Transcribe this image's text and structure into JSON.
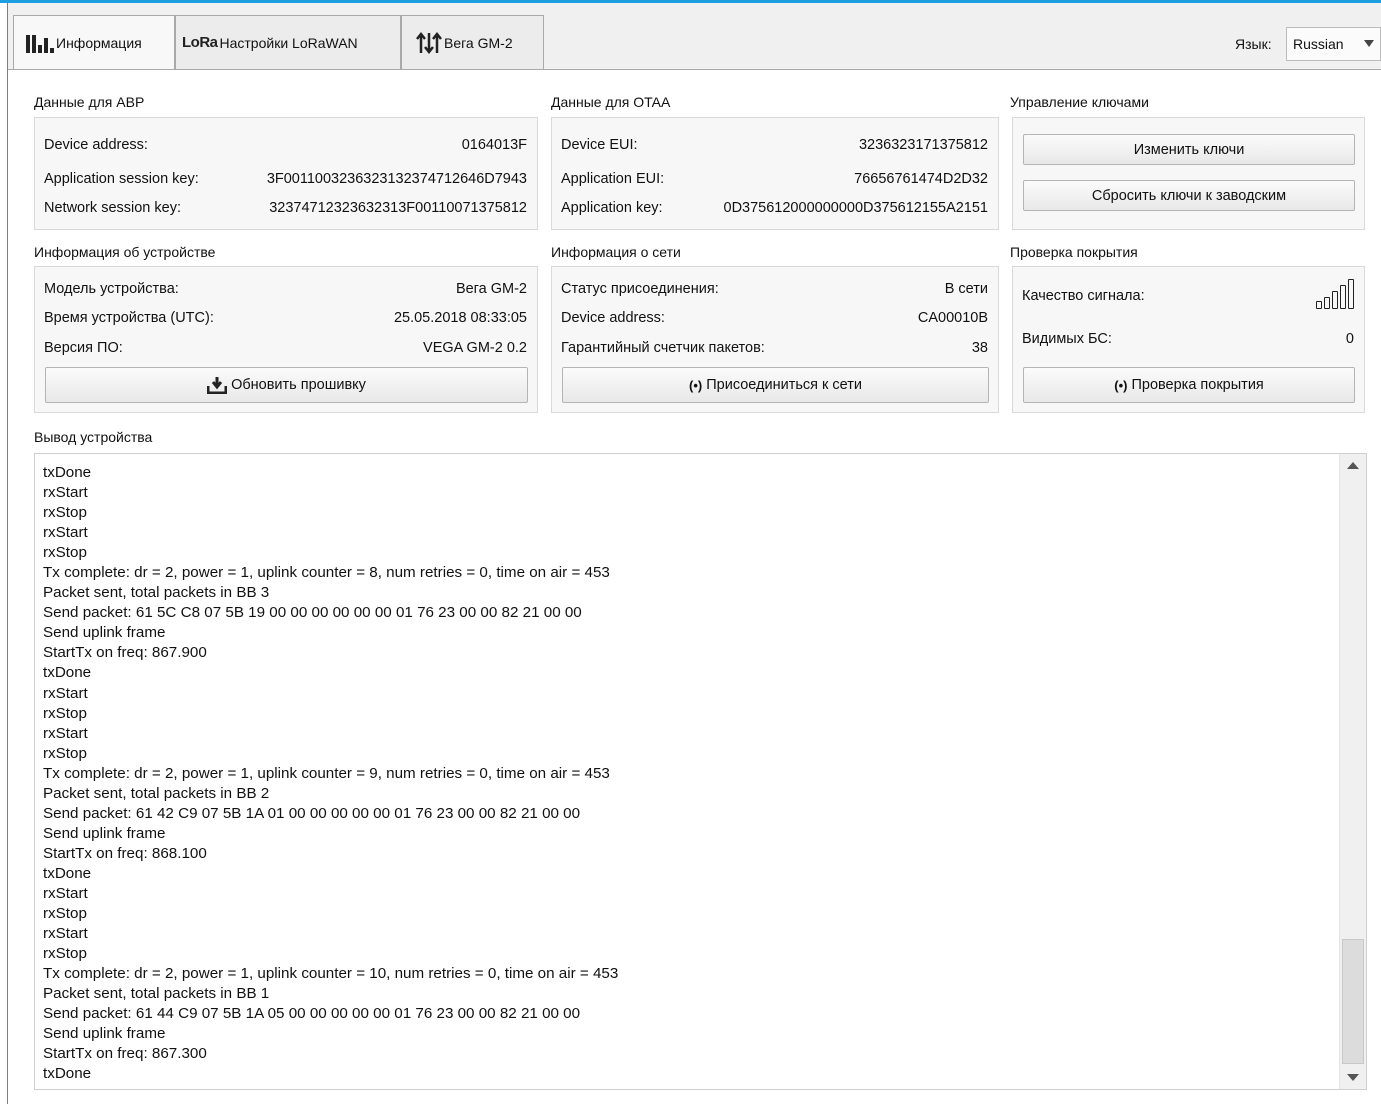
{
  "tabs": [
    {
      "label": "Информация",
      "icon": "bar-chart-icon",
      "active": true
    },
    {
      "label": "Настройки LoRaWAN",
      "logo": "LoRa",
      "icon": "lora-logo"
    },
    {
      "label": "Вега GM-2",
      "icon": "arrows-icon"
    }
  ],
  "language": {
    "label": "Язык:",
    "value": "Russian"
  },
  "abp": {
    "title": "Данные для ABP",
    "rows": [
      {
        "label": "Device address:",
        "value": "0164013F"
      },
      {
        "label": "Application session key:",
        "value": "3F00110032363231323747126 46D7943"
      },
      {
        "label": "Network session key:",
        "value": "32374712323632313F00110071375812"
      }
    ]
  },
  "otaa": {
    "title": "Данные для OTAA",
    "rows": [
      {
        "label": "Device EUI:",
        "value": "3236323171375812"
      },
      {
        "label": "Application EUI:",
        "value": "76656761474D2D32"
      },
      {
        "label": "Application key:",
        "value": "0D375612000000000D375612155A2151"
      }
    ]
  },
  "keys": {
    "title": "Управление ключами",
    "change_button": "Изменить ключи",
    "reset_button": "Сбросить ключи к заводским"
  },
  "device": {
    "title": "Информация об устройстве",
    "rows": [
      {
        "label": "Модель устройства:",
        "value": "Вега GM-2"
      },
      {
        "label": "Время устройства (UTC):",
        "value": "25.05.2018 08:33:05"
      },
      {
        "label": "Версия ПО:",
        "value": "VEGA GM-2 0.2"
      }
    ],
    "update_button": "Обновить прошивку"
  },
  "network": {
    "title": "Информация о сети",
    "rows": [
      {
        "label": "Статус присоединения:",
        "value": "В сети"
      },
      {
        "label": "Device address:",
        "value": "CA00010B"
      },
      {
        "label": "Гарантийный счетчик пакетов:",
        "value": "38"
      }
    ],
    "join_button": "Присоединиться к сети"
  },
  "coverage": {
    "title": "Проверка покрытия",
    "signal_label": "Качество сигнала:",
    "signal_bars_filled": 0,
    "signal_bars_total": 5,
    "bs_label": "Видимых БС:",
    "bs_value": "0",
    "check_button": "Проверка покрытия"
  },
  "output": {
    "title": "Вывод устройства",
    "lines": [
      "txDone",
      "rxStart",
      "rxStop",
      "rxStart",
      "rxStop",
      "Tx complete: dr = 2, power = 1, uplink counter = 8, num retries = 0, time on air = 453",
      "Packet sent, total packets in BB 3",
      "Send packet: 61 5C C8 07 5B 19 00 00 00 00 00 00 01 76 23 00 00 82 21 00 00",
      "Send uplink frame",
      "StartTx on freq: 867.900",
      "txDone",
      "rxStart",
      "rxStop",
      "rxStart",
      "rxStop",
      "Tx complete: dr = 2, power = 1, uplink counter = 9, num retries = 0, time on air = 453",
      "Packet sent, total packets in BB 2",
      "Send packet: 61 42 C9 07 5B 1A 01 00 00 00 00 00 01 76 23 00 00 82 21 00 00",
      "Send uplink frame",
      "StartTx on freq: 868.100",
      "txDone",
      "rxStart",
      "rxStop",
      "rxStart",
      "rxStop",
      "Tx complete: dr = 2, power = 1, uplink counter = 10, num retries = 0, time on air = 453",
      "Packet sent, total packets in BB 1",
      "Send packet: 61 44 C9 07 5B 1A 05 00 00 00 00 00 01 76 23 00 00 82 21 00 00",
      "Send uplink frame",
      "StartTx on freq: 867.300",
      "txDone"
    ]
  },
  "colors": {
    "accent": "#1a9fe0",
    "panel_bg": "#f7f7f7",
    "tabbar_bg": "#f0f0f0"
  }
}
